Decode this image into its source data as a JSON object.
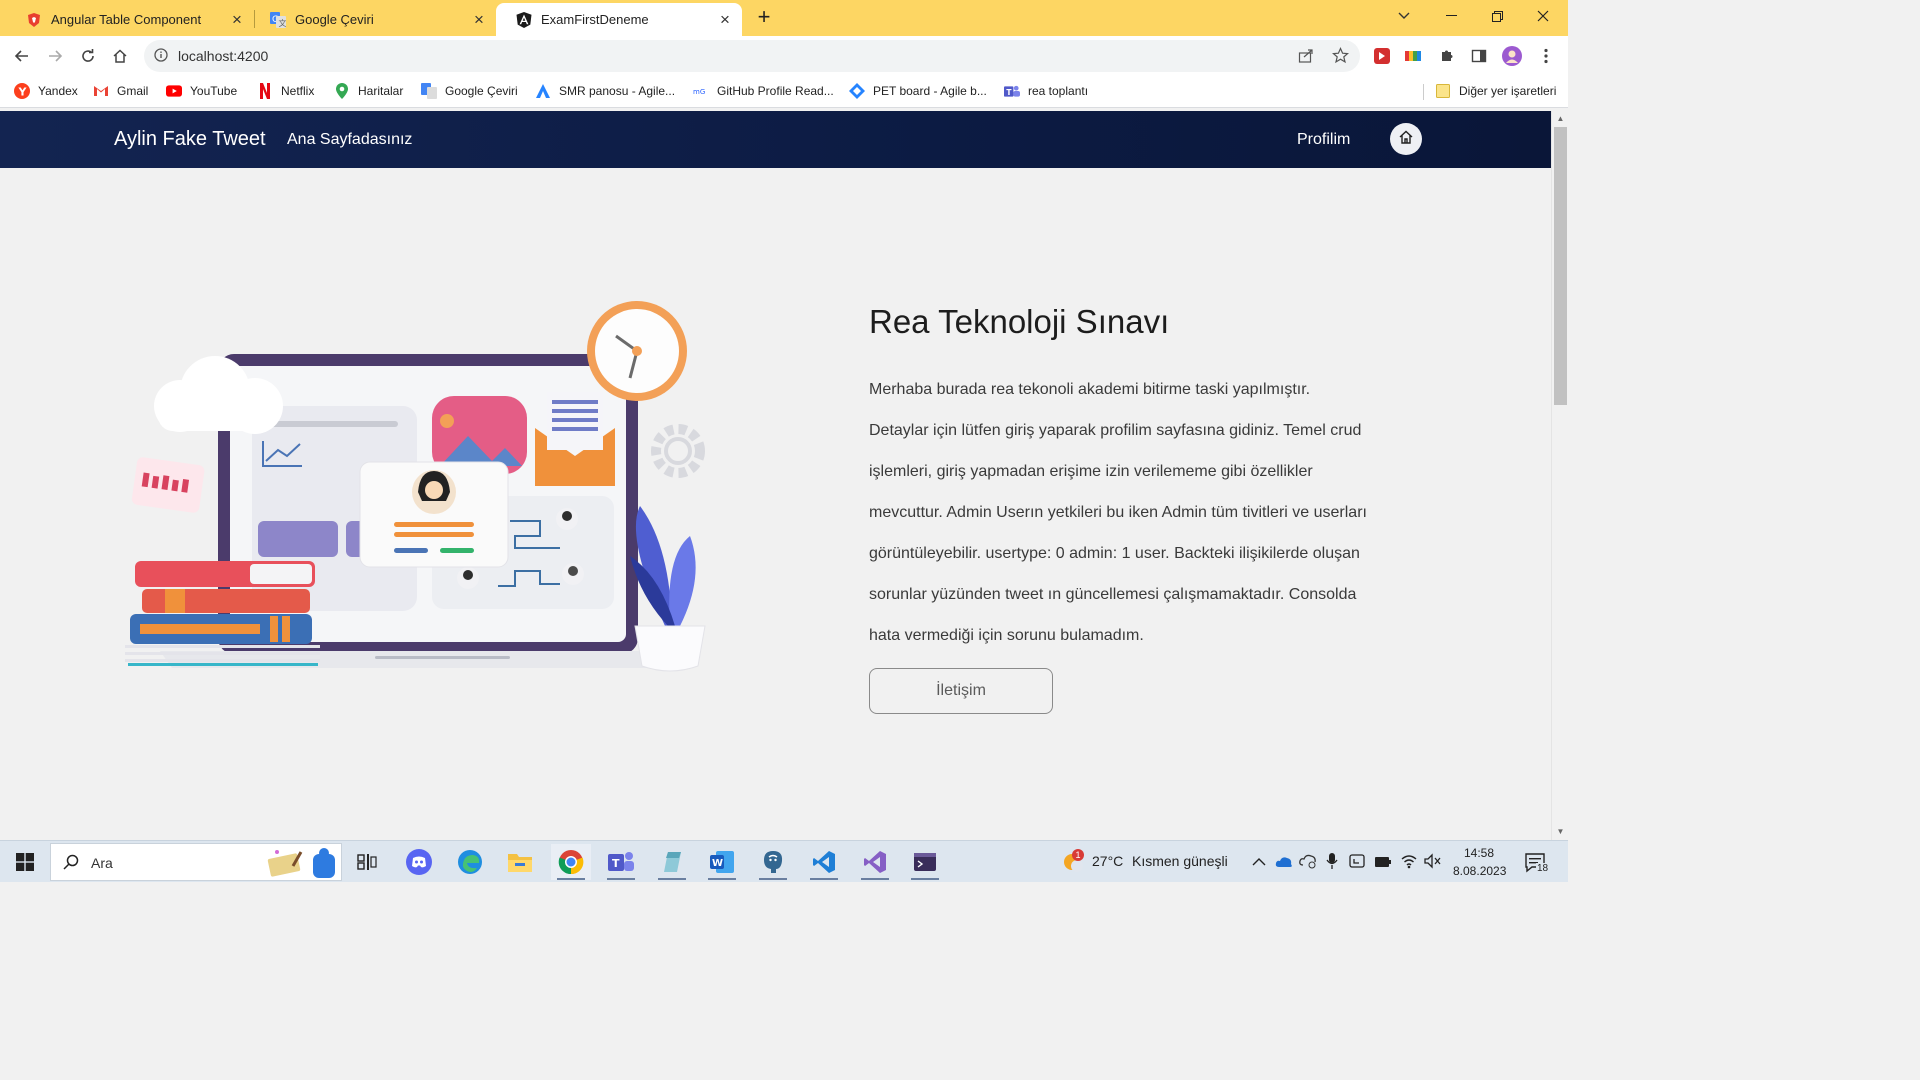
{
  "browser": {
    "tabs": [
      {
        "label": "Angular Table Component",
        "icon": "brave-shield-icon",
        "active": false
      },
      {
        "label": "Google Çeviri",
        "icon": "google-translate-icon",
        "active": false
      },
      {
        "label": "ExamFirstDeneme",
        "icon": "angular-icon",
        "active": true
      }
    ],
    "url": "localhost:4200",
    "bookmarks": [
      {
        "label": "Yandex",
        "icon": "yandex-icon"
      },
      {
        "label": "Gmail",
        "icon": "gmail-icon"
      },
      {
        "label": "YouTube",
        "icon": "youtube-icon"
      },
      {
        "label": "Netflix",
        "icon": "netflix-icon"
      },
      {
        "label": "Haritalar",
        "icon": "maps-icon"
      },
      {
        "label": "Google Çeviri",
        "icon": "google-translate-icon"
      },
      {
        "label": "SMR panosu - Agile...",
        "icon": "jira-icon"
      },
      {
        "label": "GitHub Profile Read...",
        "icon": "github-readme-icon"
      },
      {
        "label": "PET board - Agile b...",
        "icon": "jira-board-icon"
      },
      {
        "label": "rea toplantı",
        "icon": "teams-icon"
      }
    ],
    "other_bookmarks": "Diğer yer işaretleri"
  },
  "navbar": {
    "brand": "Aylin Fake Tweet",
    "home_link": "Ana Sayfadasınız",
    "profile_link": "Profilim"
  },
  "hero": {
    "title": "Rea Teknoloji Sınavı",
    "paragraph": "Merhaba burada rea tekonoli akademi bitirme taski yapılmıştır. Detaylar için lütfen giriş yaparak profilim sayfasına gidiniz. Temel crud işlemleri, giriş yapmadan erişime izin verilememe gibi özellikler mevcuttur. Admin Userın yetkileri bu iken Admin tüm tivitleri ve userları görüntüleyebilir. usertype: 0 admin: 1 user. Backteki ilişikilerde oluşan sorunlar yüzünden tweet ın güncellemesi çalışmamaktadır. Consolda hata vermediği için sorunu bulamadım.",
    "button": "İletişim"
  },
  "taskbar": {
    "search_placeholder": "Ara",
    "weather_temp": "27°C",
    "weather_desc": "Kısmen güneşli",
    "time": "14:58",
    "date": "8.08.2023",
    "notification_count": "18",
    "weather_badge": "1"
  },
  "colors": {
    "tab_strip": "#fdd663",
    "navbar": "#0d1d47",
    "page_bg": "#f1f1f1",
    "taskbar": "#dde6ef"
  }
}
